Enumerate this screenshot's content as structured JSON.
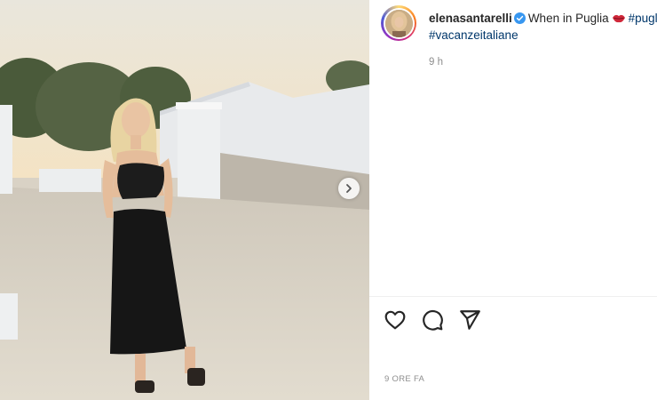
{
  "post": {
    "username": "elenasantarelli",
    "caption_text": "When in Puglia",
    "hashtag_1": "#puglia",
    "hashtag_2": "#vacanzeitaliane",
    "comment_time": "9 h",
    "post_time": "9 ORE FA"
  },
  "icons": {
    "next": "chevron-right-icon",
    "verified": "verified-badge-icon",
    "lips": "lips-emoji-icon",
    "like": "heart-icon",
    "comment": "comment-icon",
    "share": "send-icon"
  },
  "colors": {
    "hashtag": "#00376b",
    "verified": "#3897f0",
    "muted": "#8e8e8e",
    "text": "#262626"
  }
}
